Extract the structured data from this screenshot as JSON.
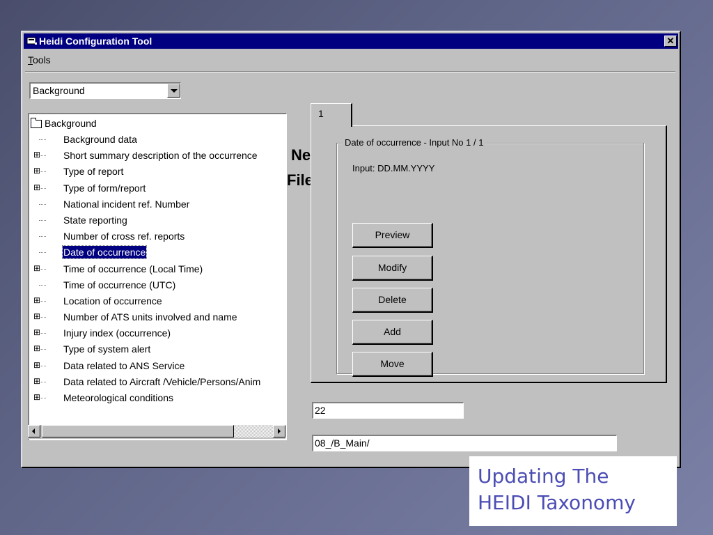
{
  "window": {
    "title": "Heidi Configuration Tool",
    "close_label": "✕"
  },
  "menu": {
    "items": [
      {
        "label": "Tools",
        "mnemonic": "T",
        "rest": "ools"
      }
    ]
  },
  "category_select": {
    "value": "Background"
  },
  "tree": {
    "root_label": "Background",
    "items": [
      {
        "label": "Background data",
        "expandable": false
      },
      {
        "label": "Short summary description of the occurrence",
        "expandable": true
      },
      {
        "label": "Type of report",
        "expandable": true
      },
      {
        "label": "Type of form/report",
        "expandable": true
      },
      {
        "label": "National incident ref. Number",
        "expandable": false
      },
      {
        "label": "State reporting",
        "expandable": false
      },
      {
        "label": "Number of cross ref. reports",
        "expandable": false
      },
      {
        "label": "Date of occurrence",
        "expandable": false,
        "selected": true
      },
      {
        "label": "Time of occurrence (Local Time)",
        "expandable": true
      },
      {
        "label": "Time of occurrence (UTC)",
        "expandable": false
      },
      {
        "label": "Location of occurrence",
        "expandable": true
      },
      {
        "label": "Number of ATS units involved and name",
        "expandable": true
      },
      {
        "label": "Injury index (occurrence)",
        "expandable": true
      },
      {
        "label": "Type of system alert",
        "expandable": true
      },
      {
        "label": "Data related to ANS Service",
        "expandable": true
      },
      {
        "label": "Data related to Aircraft /Vehicle/Persons/Anim",
        "expandable": true
      },
      {
        "label": "Meteorological conditions",
        "expandable": true
      }
    ]
  },
  "background_text": {
    "line1": "Ne",
    "line2": "File"
  },
  "tab": {
    "label": "1"
  },
  "group": {
    "legend": "Date of occurrence - Input No 1 / 1",
    "input_format": "Input: DD.MM.YYYY",
    "buttons": {
      "preview": "Preview",
      "modify": "Modify",
      "delete": "Delete",
      "add": "Add",
      "move": "Move"
    }
  },
  "fields": {
    "code": "22",
    "path": "08_/B_Main/"
  },
  "slide_caption": {
    "line1": "Updating The",
    "line2": "HEIDI Taxonomy",
    "color": "#4b4db4"
  },
  "colors": {
    "titlebar": "#000080",
    "window_face": "#c0c0c0",
    "selection": "#000080"
  }
}
